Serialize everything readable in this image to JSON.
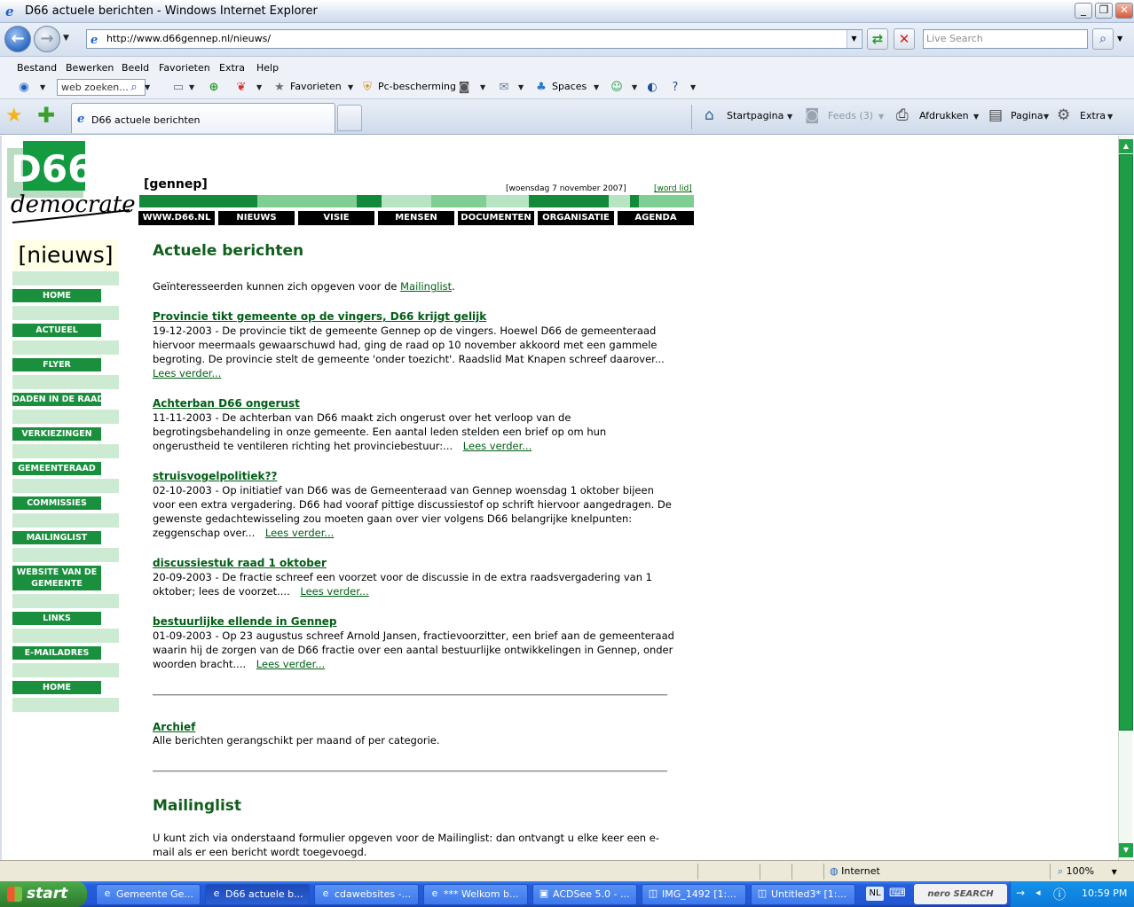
{
  "window": {
    "title": "D66 actuele berichten - Windows Internet Explorer"
  },
  "address": {
    "url": "http://www.d66gennep.nl/nieuws/",
    "search_placeholder": "Live Search"
  },
  "menu": [
    "Bestand",
    "Bewerken",
    "Beeld",
    "Favorieten",
    "Extra",
    "Help"
  ],
  "links_toolbar": {
    "search_placeholder": "web zoeken...",
    "favorieten": "Favorieten",
    "pc_bescherming": "Pc-bescherming",
    "spaces": "Spaces"
  },
  "tabs": {
    "active_label": "D66 actuele berichten"
  },
  "commands": {
    "startpagina": "Startpagina",
    "feeds": "Feeds (3)",
    "afdrukken": "Afdrukken",
    "pagina": "Pagina",
    "extra": "Extra"
  },
  "site": {
    "logo_text": "D66",
    "logo_script": "democraten",
    "city": "[gennep]",
    "date": "[woensdag 7 november 2007]",
    "word_lid": "[word lid]",
    "strip_colors": [
      "#13893a",
      "#7fcf95",
      "#13893a",
      "#b7e4c3",
      "#7fcf95",
      "#b7e4c3",
      "#13893a",
      "#b7e4c3",
      "#13893a",
      "#7fcf95"
    ],
    "top_nav": [
      "WWW.D66.NL",
      "NIEUWS",
      "VISIE",
      "MENSEN",
      "DOCUMENTEN",
      "ORGANISATIE",
      "AGENDA"
    ],
    "section_badge": "[nieuws]",
    "side_nav": [
      "HOME",
      "ACTUEEL",
      "FLYER",
      "DADEN IN DE RAAD",
      "VERKIEZINGEN",
      "GEMEENTERAAD",
      "COMMISSIES",
      "MAILINGLIST",
      "WEBSITE VAN DE GEMEENTE",
      "LINKS",
      "E-MAILADRES",
      "HOME"
    ],
    "main": {
      "heading": "Actuele berichten",
      "intro_text": "Geïnteresseerden kunnen zich opgeven voor de ",
      "intro_link": "Mailinglist",
      "intro_end": ".",
      "lees_verder": "Lees verder...",
      "articles": [
        {
          "title": "Provincie tikt gemeente op de vingers, D66 krijgt gelijk",
          "body": "19-12-2003 - De provincie tikt de gemeente Gennep op de vingers. Hoewel D66 de gemeenteraad hiervoor meermaals gewaarschuwd had, ging de raad op 10 november akkoord met een gammele begroting. De provincie stelt de gemeente 'onder toezicht'. Raadslid Mat Knapen schreef daarover..."
        },
        {
          "title": "Achterban D66 ongerust",
          "body": "11-11-2003 - De achterban van D66 maakt zich ongerust over het verloop van de begrotingsbehandeling in onze gemeente. Een aantal leden stelden een brief op om hun ongerustheid te ventileren richting het provinciebestuur:..."
        },
        {
          "title": "struisvogelpolitiek??",
          "body": "02-10-2003 - Op initiatief van D66 was de Gemeenteraad van Gennep woensdag 1 oktober bijeen voor een extra vergadering. D66 had vooraf pittige discussiestof op schrift hiervoor aangedragen. De gewenste gedachtewisseling zou moeten gaan over vier volgens D66 belangrijke knelpunten: zeggenschap over..."
        },
        {
          "title": "discussiestuk raad 1 oktober",
          "body": "20-09-2003 - De fractie schreef een voorzet voor de discussie in de extra raadsvergadering van 1 oktober; lees de voorzet...."
        },
        {
          "title": "bestuurlijke ellende in Gennep",
          "body": "01-09-2003 - Op 23 augustus schreef Arnold Jansen, fractievoorzitter, een brief aan de gemeenteraad waarin hij de zorgen van de D66 fractie over een aantal bestuurlijke ontwikkelingen in Gennep, onder woorden bracht...."
        }
      ],
      "archief_title": "Archief",
      "archief_desc": "Alle berichten gerangschikt per maand of per categorie.",
      "mailing_heading": "Mailinglist",
      "mailing_text": "U kunt zich via onderstaand formulier opgeven voor de Mailinglist: dan ontvangt u elke keer een e-mail als er een bericht wordt toegevoegd."
    }
  },
  "status": {
    "zone": "Internet",
    "zoom": "100%"
  },
  "taskbar": {
    "start": "start",
    "tasks": [
      "Gemeente Ge...",
      "D66 actuele b...",
      "cdawebsites -...",
      "*** Welkom b...",
      "ACDSee 5.0 - ...",
      "IMG_1492 [1:...",
      "Untitled3* [1:..."
    ],
    "lang": "NL",
    "nero": "nero SEARCH",
    "clock": "10:59 PM"
  }
}
